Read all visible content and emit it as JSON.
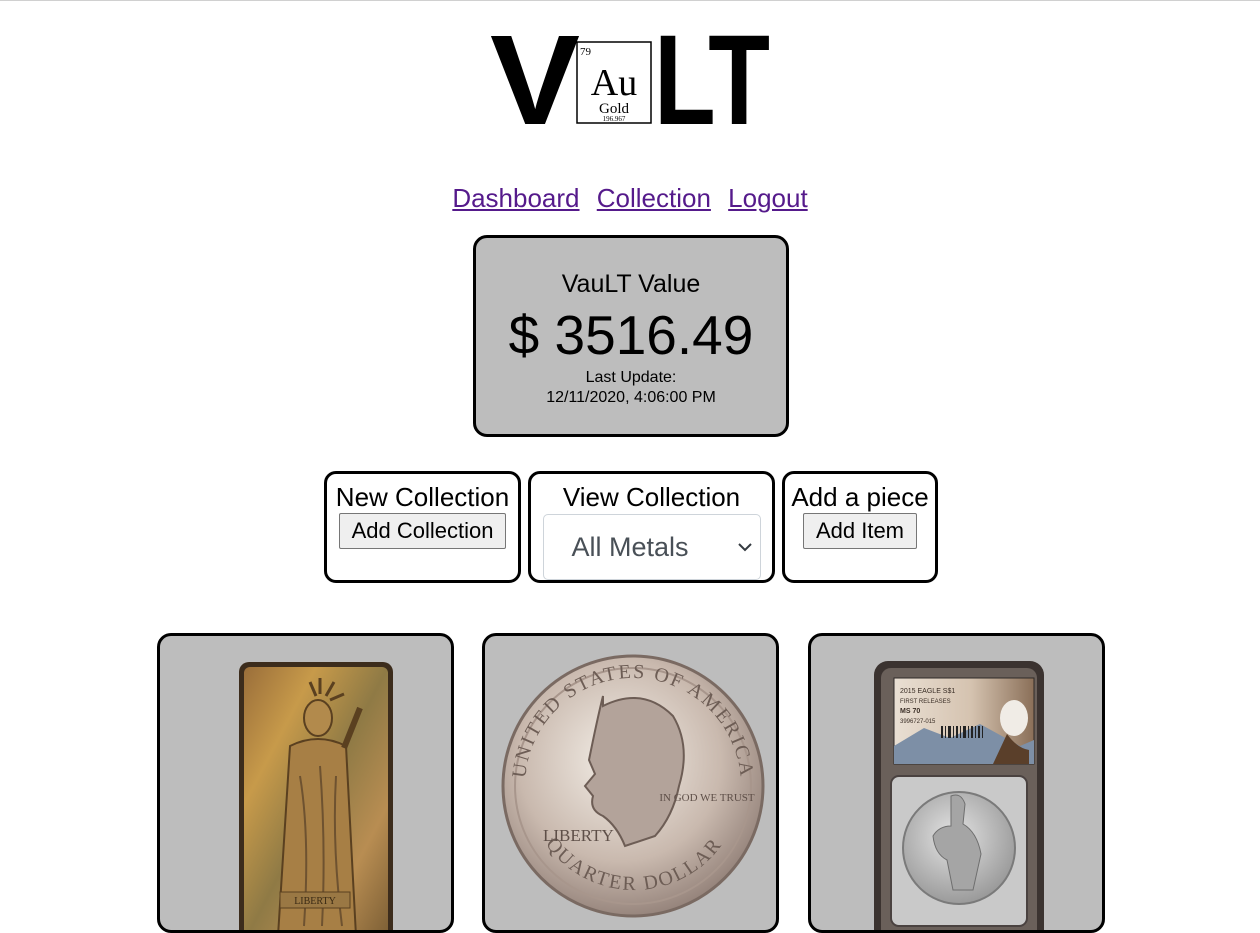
{
  "logo": {
    "letters_left": "V",
    "letters_right": "LT",
    "element_number": "79",
    "element_symbol": "Au",
    "element_name": "Gold",
    "element_mass": "196.967"
  },
  "nav": {
    "links": [
      "Dashboard",
      "Collection",
      "Logout"
    ]
  },
  "vault_value": {
    "title": "VauLT Value",
    "amount": "$ 3516.49",
    "last_update_label": "Last Update:",
    "last_update_time": "12/11/2020, 4:06:00 PM"
  },
  "actions": {
    "new_collection": {
      "title": "New Collection",
      "button": "Add Collection"
    },
    "view_collection": {
      "title": "View Collection",
      "selected": "All Metals"
    },
    "add_piece": {
      "title": "Add a piece",
      "button": "Add Item"
    }
  },
  "items": [
    {
      "image": "liberty-silver-bar",
      "engraving": "LIBERTY"
    },
    {
      "image": "washington-quarter-coin",
      "rim_top": "UNITED STATES OF AMERICA",
      "rim_bottom": "QUARTER DOLLAR",
      "left_word": "LIBERTY",
      "motto": "IN GOD WE TRUST"
    },
    {
      "image": "slabbed-silver-eagle",
      "label_line1": "2015 EAGLE S$1",
      "label_line2": "FIRST RELEASES",
      "label_line3": "MS 70",
      "label_line4": "3996727-015"
    }
  ],
  "colors": {
    "card_bg": "#bdbdbd",
    "link": "#551a8b",
    "border": "#000000"
  }
}
